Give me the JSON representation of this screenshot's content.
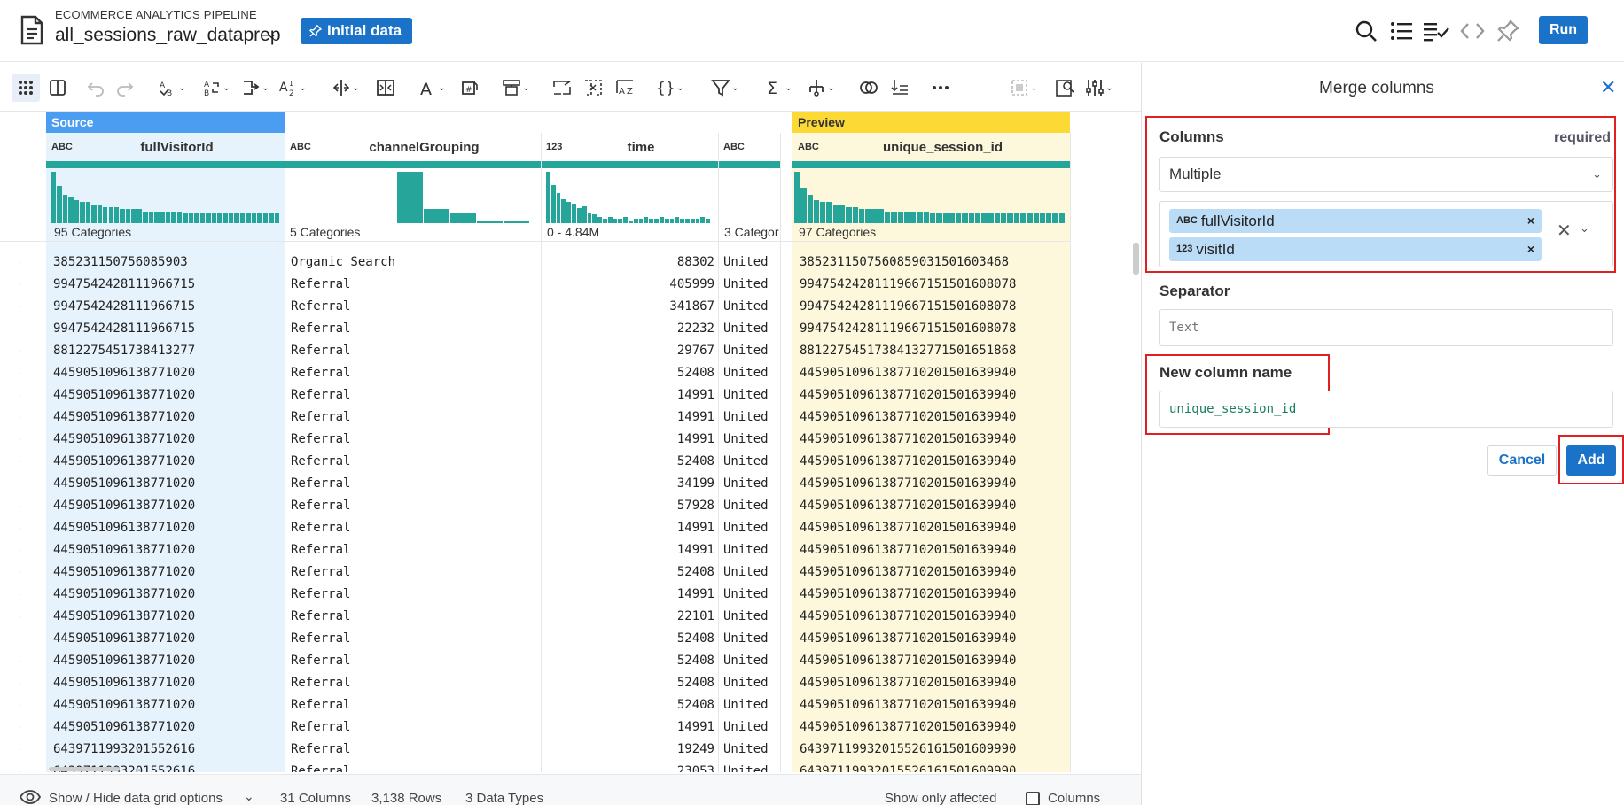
{
  "header": {
    "pipeline_label": "ECOMMERCE ANALYTICS PIPELINE",
    "recipe_name": "all_sessions_raw_dataprep",
    "initial_data_label": "Initial data",
    "run_label": "Run",
    "icons": [
      "search-icon",
      "list-icon",
      "checklist-icon",
      "code-icon",
      "pin-icon"
    ]
  },
  "toolbar": {
    "icons": [
      "grid-view-icon",
      "columns-view-icon",
      "undo-icon",
      "redo-icon",
      "format-icon",
      "replace-icon",
      "merge-icon",
      "sort-icon",
      "split-icon",
      "extract-icon",
      "text-icon",
      "count-icon",
      "restructure-icon",
      "rename-icon",
      "missing-icon",
      "transform-icon",
      "json-icon",
      "filter-icon",
      "sum-icon",
      "pivot-icon",
      "join-icon",
      "fill-icon",
      "more-icon",
      "select-icon",
      "export-icon",
      "settings-icon"
    ]
  },
  "grid": {
    "source_label": "Source",
    "preview_label": "Preview",
    "columns": [
      {
        "name": "fullVisitorId",
        "type": "string",
        "type_label": "ABC",
        "stat": "95 Categories"
      },
      {
        "name": "channelGrouping",
        "type": "string",
        "type_label": "ABC",
        "stat": "5 Categories"
      },
      {
        "name": "time",
        "type": "integer",
        "type_label": "123",
        "stat": "0 - 4.84M"
      },
      {
        "name": "",
        "type": "string",
        "type_label": "ABC",
        "stat": "3 Categor"
      },
      {
        "name": "unique_session_id",
        "type": "string",
        "type_label": "ABC",
        "stat": "97 Categories"
      }
    ],
    "histograms": {
      "fullVisitorId": [
        22,
        16,
        12,
        11,
        10,
        9,
        9,
        8,
        8,
        7,
        7,
        7,
        6,
        6,
        6,
        6,
        5,
        5,
        5,
        5,
        5,
        5,
        5,
        4,
        4,
        4,
        4,
        4,
        4,
        4,
        4,
        4,
        4,
        4,
        4,
        4,
        4,
        4,
        4,
        4
      ],
      "channelGrouping": [
        0,
        0,
        0,
        0,
        50,
        14,
        10,
        2,
        2
      ],
      "time": [
        24,
        18,
        14,
        11,
        10,
        9,
        7,
        8,
        5,
        4,
        3,
        2,
        3,
        2,
        2,
        3,
        1,
        2,
        2,
        3,
        2,
        2,
        3,
        2,
        2,
        3,
        2,
        2,
        2,
        2,
        3,
        2
      ],
      "unique_session_id": [
        22,
        15,
        12,
        10,
        9,
        9,
        8,
        8,
        7,
        7,
        6,
        6,
        6,
        6,
        5,
        5,
        5,
        5,
        5,
        5,
        5,
        4,
        4,
        4,
        4,
        4,
        4,
        4,
        4,
        4,
        4,
        4,
        4,
        4,
        4,
        4,
        4,
        4,
        4,
        4,
        4,
        4
      ]
    },
    "rows": [
      [
        "385231150756085903",
        "Organic Search",
        "88302",
        "United",
        "3852311507560859031501603468"
      ],
      [
        "9947542428111966715",
        "Referral",
        "405999",
        "United",
        "99475424281119667151501608078"
      ],
      [
        "9947542428111966715",
        "Referral",
        "341867",
        "United",
        "99475424281119667151501608078"
      ],
      [
        "9947542428111966715",
        "Referral",
        "22232",
        "United",
        "99475424281119667151501608078"
      ],
      [
        "8812275451738413277",
        "Referral",
        "29767",
        "United",
        "88122754517384132771501651868"
      ],
      [
        "4459051096138771020",
        "Referral",
        "52408",
        "United",
        "44590510961387710201501639940"
      ],
      [
        "4459051096138771020",
        "Referral",
        "14991",
        "United",
        "44590510961387710201501639940"
      ],
      [
        "4459051096138771020",
        "Referral",
        "14991",
        "United",
        "44590510961387710201501639940"
      ],
      [
        "4459051096138771020",
        "Referral",
        "14991",
        "United",
        "44590510961387710201501639940"
      ],
      [
        "4459051096138771020",
        "Referral",
        "52408",
        "United",
        "44590510961387710201501639940"
      ],
      [
        "4459051096138771020",
        "Referral",
        "34199",
        "United",
        "44590510961387710201501639940"
      ],
      [
        "4459051096138771020",
        "Referral",
        "57928",
        "United",
        "44590510961387710201501639940"
      ],
      [
        "4459051096138771020",
        "Referral",
        "14991",
        "United",
        "44590510961387710201501639940"
      ],
      [
        "4459051096138771020",
        "Referral",
        "14991",
        "United",
        "44590510961387710201501639940"
      ],
      [
        "4459051096138771020",
        "Referral",
        "52408",
        "United",
        "44590510961387710201501639940"
      ],
      [
        "4459051096138771020",
        "Referral",
        "14991",
        "United",
        "44590510961387710201501639940"
      ],
      [
        "4459051096138771020",
        "Referral",
        "22101",
        "United",
        "44590510961387710201501639940"
      ],
      [
        "4459051096138771020",
        "Referral",
        "52408",
        "United",
        "44590510961387710201501639940"
      ],
      [
        "4459051096138771020",
        "Referral",
        "52408",
        "United",
        "44590510961387710201501639940"
      ],
      [
        "4459051096138771020",
        "Referral",
        "52408",
        "United",
        "44590510961387710201501639940"
      ],
      [
        "4459051096138771020",
        "Referral",
        "52408",
        "United",
        "44590510961387710201501639940"
      ],
      [
        "4459051096138771020",
        "Referral",
        "14991",
        "United",
        "44590510961387710201501639940"
      ],
      [
        "6439711993201552616",
        "Referral",
        "19249",
        "United",
        "64397119932015526161501609990"
      ],
      [
        "6439711993201552616",
        "Referral",
        "23053",
        "United",
        "64397119932015526161501609990"
      ]
    ]
  },
  "footer": {
    "show_hide_label": "Show / Hide data grid options",
    "columns_count": "31 Columns",
    "rows_count": "3,138 Rows",
    "types_count": "3 Data Types",
    "show_only_affected_label": "Show only affected",
    "columns_checkbox_label": "Columns"
  },
  "panel": {
    "title": "Merge columns",
    "columns_label": "Columns",
    "required_label": "required",
    "mode_value": "Multiple",
    "selected_columns": [
      {
        "type_label": "ABC",
        "name": "fullVisitorId"
      },
      {
        "type_label": "123",
        "name": "visitId"
      }
    ],
    "separator_label": "Separator",
    "separator_placeholder": "Text",
    "new_column_label": "New column name",
    "new_column_value": "unique_session_id",
    "cancel_label": "Cancel",
    "add_label": "Add"
  },
  "colors": {
    "accent": "#1a73c8",
    "source_band": "#4a9df0",
    "preview_band": "#fcd935",
    "source_column_bg": "#e6f2fc",
    "preview_column_bg": "#fdf8dc",
    "histogram": "#26a69a",
    "highlight_box": "#e02020"
  }
}
